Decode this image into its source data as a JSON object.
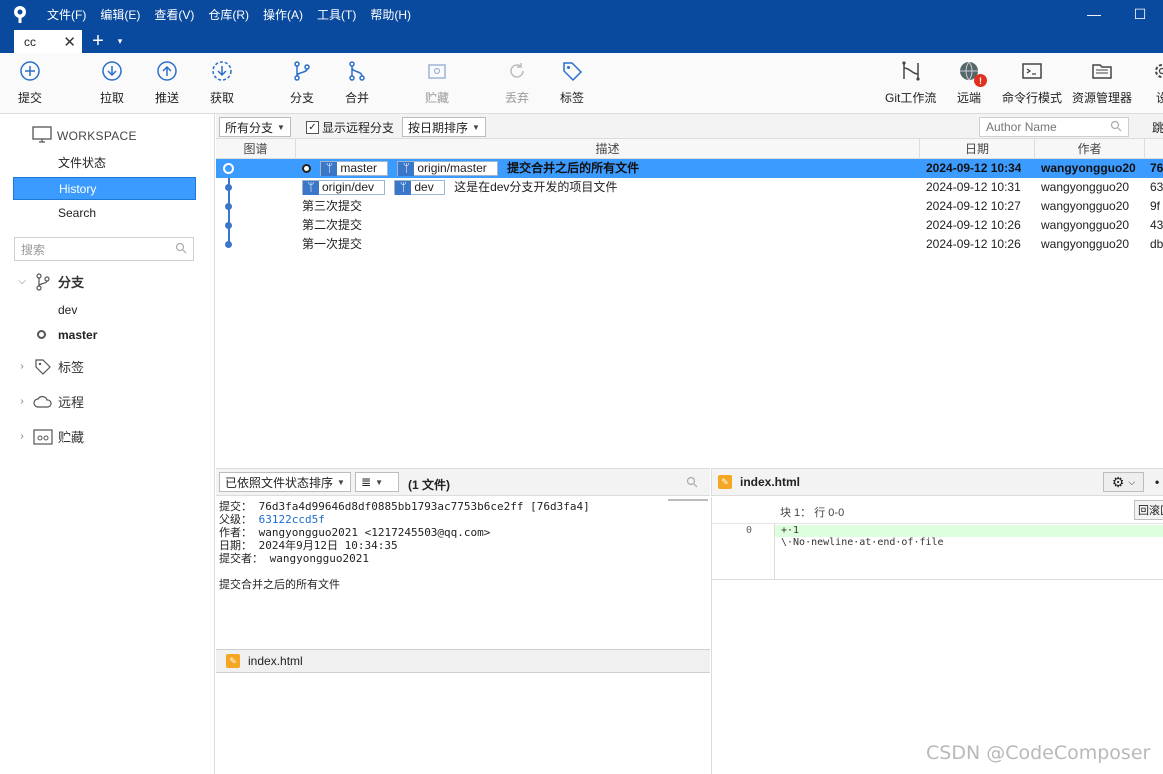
{
  "menu": [
    "文件(F)",
    "编辑(E)",
    "查看(V)",
    "仓库(R)",
    "操作(A)",
    "工具(T)",
    "帮助(H)"
  ],
  "window_controls": {
    "minimize": "—",
    "maximize": "☐"
  },
  "tab": {
    "title": "cc",
    "close": "✕",
    "add": "+",
    "menu": "▾"
  },
  "toolbar": {
    "commit": "提交",
    "pull": "拉取",
    "push": "推送",
    "fetch": "获取",
    "branch": "分支",
    "merge": "合并",
    "stash": "贮藏",
    "discard": "丢弃",
    "tag": "标签",
    "gitflow": "Git工作流",
    "remote": "远端",
    "terminal": "命令行模式",
    "explorer": "资源管理器",
    "settings": "设"
  },
  "sidebar": {
    "workspace": "WORKSPACE",
    "links": [
      "文件状态",
      "History",
      "Search"
    ],
    "search_placeholder": "搜索",
    "branches_label": "分支",
    "branches": [
      "dev",
      "master"
    ],
    "tags_label": "标签",
    "remotes_label": "远程",
    "stashes_label": "贮藏"
  },
  "history_toolbar": {
    "branches_filter": "所有分支",
    "show_remote": "显示远程分支",
    "sort": "按日期排序",
    "author_placeholder": "Author Name",
    "jump": "跳"
  },
  "columns": {
    "graph": "图谱",
    "desc": "描述",
    "date": "日期",
    "author": "作者"
  },
  "commits": [
    {
      "refs": [
        "master",
        "origin/master"
      ],
      "message": "提交合并之后的所有文件",
      "date": "2024-09-12 10:34",
      "author": "wangyongguo20",
      "hash": "76"
    },
    {
      "refs": [
        "origin/dev",
        "dev"
      ],
      "message": "这是在dev分支开发的项目文件",
      "date": "2024-09-12 10:31",
      "author": "wangyongguo20",
      "hash": "63"
    },
    {
      "refs": [],
      "message": "第三次提交",
      "date": "2024-09-12 10:27",
      "author": "wangyongguo20",
      "hash": "9f"
    },
    {
      "refs": [],
      "message": "第二次提交",
      "date": "2024-09-12 10:26",
      "author": "wangyongguo20",
      "hash": "43"
    },
    {
      "refs": [],
      "message": "第一次提交",
      "date": "2024-09-12 10:26",
      "author": "wangyongguo20",
      "hash": "db"
    }
  ],
  "bottom_toolbar": {
    "sort": "已依照文件状态排序",
    "view": "≣",
    "file_count": "(1 文件)"
  },
  "commit_detail": {
    "commit_label": "提交：",
    "commit": "76d3fa4d99646d8df0885bb1793ac7753b6ce2ff [76d3fa4]",
    "parent_label": "父级：",
    "parent": "63122ccd5f",
    "author_label": "作者：",
    "author": "wangyongguo2021 <1217245503@qq.com>",
    "date_label": "日期：",
    "date": "2024年9月12日 10:34:35",
    "committer_label": "提交者：",
    "committer": "wangyongguo2021",
    "message": "提交合并之后的所有文件"
  },
  "files": [
    "index.html"
  ],
  "diff": {
    "file": "index.html",
    "hunk": "块 1： 行 0-0",
    "revert": "回滚区",
    "line_no": "0",
    "lines": [
      "+·1",
      "\\·No·newline·at·end·of·file"
    ]
  },
  "watermark": "CSDN @CodeComposer",
  "colors": {
    "titlebar": "#0a4a9e",
    "selection": "#3c9bff",
    "graph": "#3a77c9",
    "file_modified": "#f5a623"
  }
}
